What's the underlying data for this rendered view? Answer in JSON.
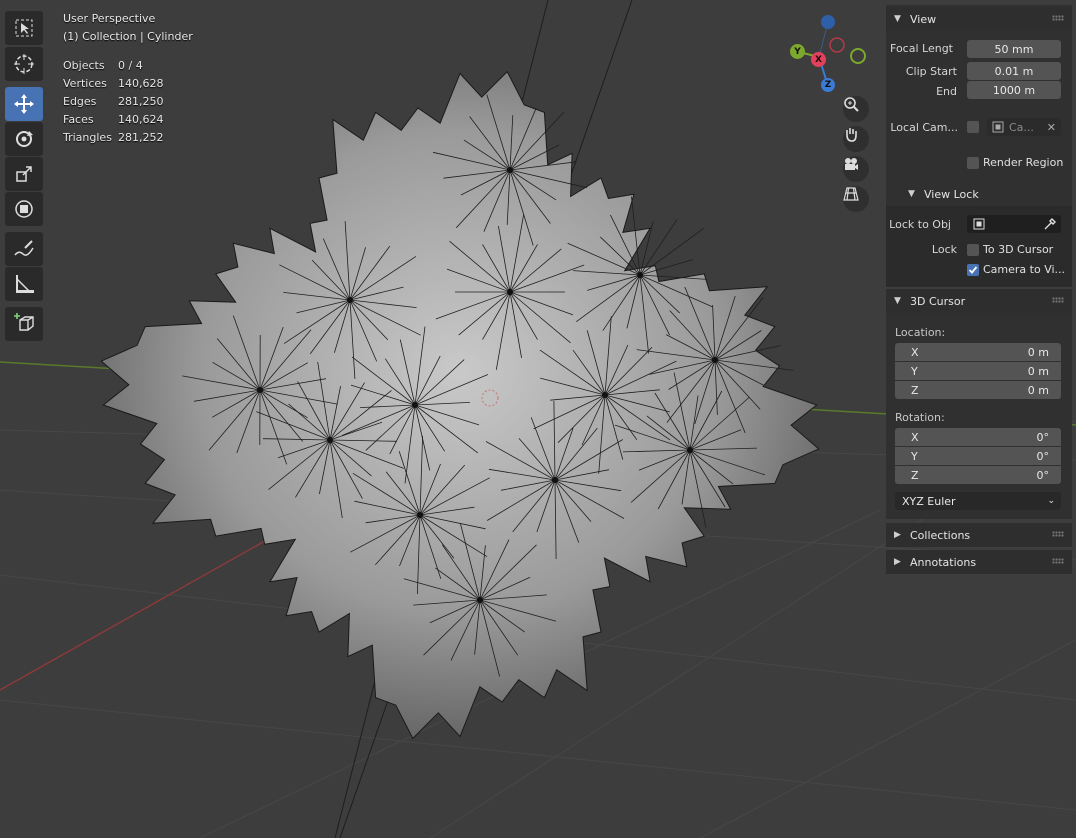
{
  "viewport": {
    "mode": "User Perspective",
    "context": "(1) Collection | Cylinder",
    "stats": [
      {
        "label": "Objects",
        "value": "0 / 4"
      },
      {
        "label": "Vertices",
        "value": "140,628"
      },
      {
        "label": "Edges",
        "value": "281,250"
      },
      {
        "label": "Faces",
        "value": "140,624"
      },
      {
        "label": "Triangles",
        "value": "281,252"
      }
    ],
    "gizmo": {
      "y": "Y",
      "x": "X",
      "z": "Z"
    }
  },
  "toolbar": {
    "tools": [
      {
        "icon": "select-box-icon",
        "active": false
      },
      {
        "icon": "cursor-icon",
        "active": false
      },
      {
        "icon": "move-icon",
        "active": true
      },
      {
        "icon": "rotate-icon",
        "active": false
      },
      {
        "icon": "scale-icon",
        "active": false
      },
      {
        "icon": "transform-icon",
        "active": false
      },
      {
        "icon": "annotate-icon",
        "active": false
      },
      {
        "icon": "measure-icon",
        "active": false
      },
      {
        "icon": "add-cube-icon",
        "active": false
      }
    ]
  },
  "sidebar": {
    "view": {
      "title": "View",
      "focal_length_label": "Focal Lengt",
      "focal_length": "50 mm",
      "clip_start_label": "Clip Start",
      "clip_start": "0.01 m",
      "end_label": "End",
      "end": "1000 m",
      "local_camera_label": "Local Cam...",
      "local_camera_value": "Ca...",
      "render_region_label": "Render Region",
      "render_region": false
    },
    "view_lock": {
      "title": "View Lock",
      "lock_to_obj_label": "Lock to Obj",
      "lock_label": "Lock",
      "to_3d_cursor_label": "To 3D Cursor",
      "to_3d_cursor": false,
      "camera_to_view_label": "Camera to Vi...",
      "camera_to_view": true
    },
    "cursor": {
      "title": "3D Cursor",
      "location_label": "Location:",
      "location": [
        {
          "axis": "X",
          "value": "0 m"
        },
        {
          "axis": "Y",
          "value": "0 m"
        },
        {
          "axis": "Z",
          "value": "0 m"
        }
      ],
      "rotation_label": "Rotation:",
      "rotation": [
        {
          "axis": "X",
          "value": "0°"
        },
        {
          "axis": "Y",
          "value": "0°"
        },
        {
          "axis": "Z",
          "value": "0°"
        }
      ],
      "rotation_mode": "XYZ Euler"
    },
    "collections": {
      "title": "Collections"
    },
    "annotations": {
      "title": "Annotations"
    }
  },
  "colors": {
    "background": "#3d3d3d",
    "accent": "#4772b3",
    "axis_x": "#e4405b",
    "axis_y": "#7ca82d",
    "axis_z": "#3a7bd5",
    "x_axis_line": "#8a3a3a",
    "y_axis_line": "#5a7a2a"
  }
}
